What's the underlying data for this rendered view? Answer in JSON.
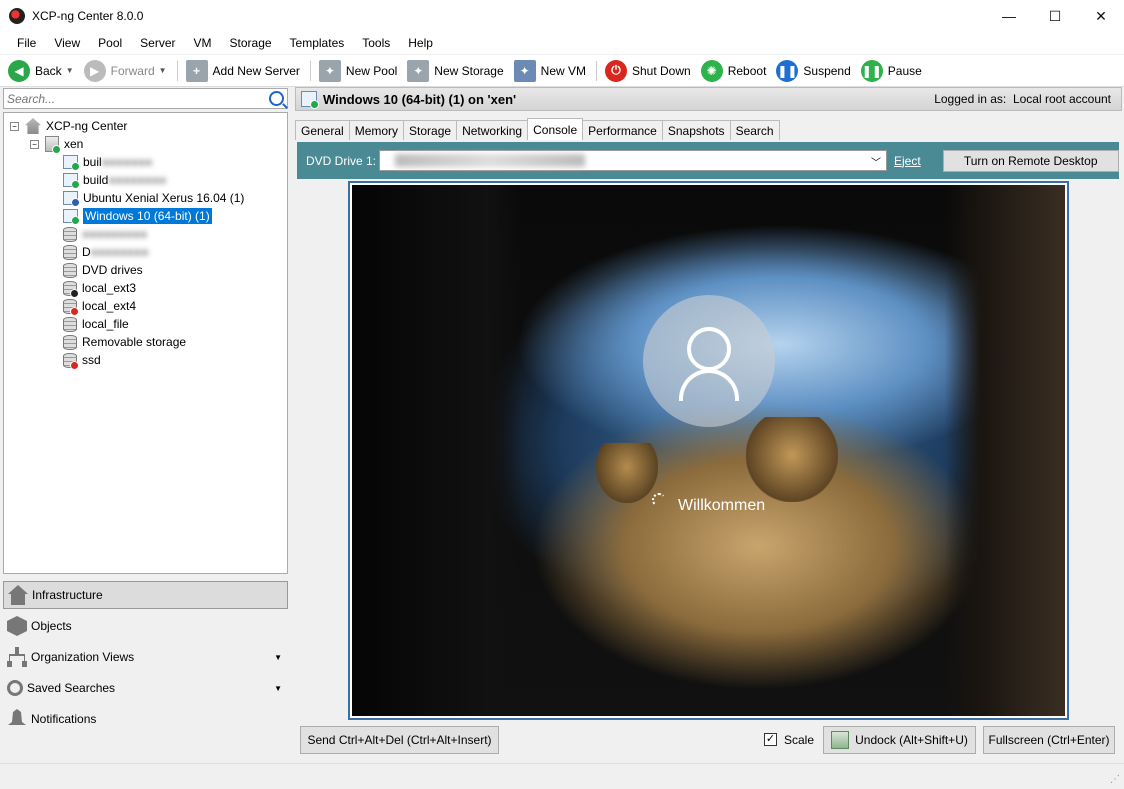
{
  "window": {
    "title": "XCP-ng Center 8.0.0",
    "minimize": "—",
    "maximize": "☐",
    "close": "✕"
  },
  "menu": [
    "File",
    "View",
    "Pool",
    "Server",
    "VM",
    "Storage",
    "Templates",
    "Tools",
    "Help"
  ],
  "toolbar": {
    "back": "Back",
    "forward": "Forward",
    "add_server": "Add New Server",
    "new_pool": "New Pool",
    "new_storage": "New Storage",
    "new_vm": "New VM",
    "shut_down": "Shut Down",
    "reboot": "Reboot",
    "suspend": "Suspend",
    "pause": "Pause",
    "colors": {
      "back": "#2aa748",
      "shutdown": "#d9271d",
      "reboot": "#2fb14b",
      "suspend": "#1f6fd2",
      "pause": "#2fb14b"
    }
  },
  "search": {
    "placeholder": "Search..."
  },
  "tree": {
    "root": "XCP-ng Center",
    "server": "xen",
    "items": [
      {
        "label": "buil",
        "icon": "vm-running-icon"
      },
      {
        "label": "build",
        "icon": "vm-running-icon"
      },
      {
        "label": "Ubuntu Xenial Xerus 16.04 (1)",
        "icon": "vm-suspended-icon"
      },
      {
        "label": "Windows 10 (64-bit) (1)",
        "icon": "vm-running-icon"
      },
      {
        "label": "",
        "icon": "storage-icon"
      },
      {
        "label": "D",
        "icon": "storage-icon"
      },
      {
        "label": "DVD drives",
        "icon": "storage-icon"
      },
      {
        "label": "local_ext3",
        "icon": "storage-default-icon"
      },
      {
        "label": "local_ext4",
        "icon": "storage-error-icon"
      },
      {
        "label": "local_file",
        "icon": "storage-icon"
      },
      {
        "label": "Removable storage",
        "icon": "storage-icon"
      },
      {
        "label": "ssd",
        "icon": "storage-error-icon"
      }
    ]
  },
  "nav": {
    "infrastructure": "Infrastructure",
    "objects": "Objects",
    "org_views": "Organization Views",
    "saved_searches": "Saved Searches",
    "notifications": "Notifications"
  },
  "header": {
    "title": "Windows 10 (64-bit) (1) on 'xen'",
    "login_label": "Logged in as:",
    "login_value": "Local root account"
  },
  "tabs": [
    "General",
    "Memory",
    "Storage",
    "Networking",
    "Console",
    "Performance",
    "Snapshots",
    "Search"
  ],
  "active_tab": "Console",
  "dvd": {
    "label": "DVD Drive 1:",
    "eject": "Eject",
    "remote_desktop": "Turn on Remote Desktop"
  },
  "console_screen": {
    "welcome": "Willkommen"
  },
  "bottom": {
    "send_cad": "Send Ctrl+Alt+Del (Ctrl+Alt+Insert)",
    "scale_checked": "✓",
    "scale": "Scale",
    "undock": "Undock (Alt+Shift+U)",
    "fullscreen": "Fullscreen (Ctrl+Enter)"
  }
}
